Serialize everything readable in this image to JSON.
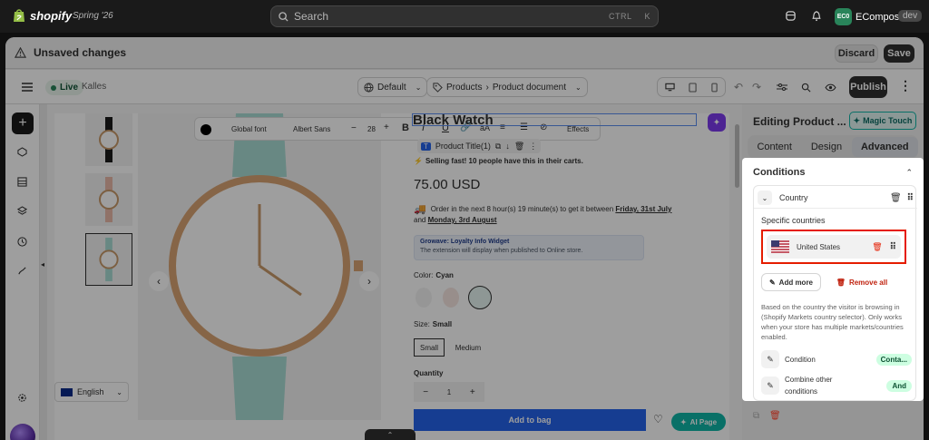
{
  "topbar": {
    "brand": "shopify",
    "season": "Spring '26",
    "search_placeholder": "Search",
    "shortcut_ctrl": "CTRL",
    "shortcut_key": "K",
    "avatar": "EC0",
    "store_name": "EComposer",
    "dev_badge": "dev"
  },
  "unsaved": {
    "title": "Unsaved changes",
    "discard": "Discard",
    "save": "Save"
  },
  "toolbar": {
    "live": "Live",
    "theme": "Kalles",
    "default": "Default",
    "products": "Products",
    "product_doc": "Product document",
    "publish": "Publish"
  },
  "text_toolbar": {
    "global_font": "Global font",
    "font_family": "Albert Sans",
    "font_size": "28",
    "effects": "Effects"
  },
  "product": {
    "title": "Black Watch",
    "element_label": "Product Title(1)",
    "urgency": "Selling fast! 10 people have this in their carts.",
    "price": "75.00 USD",
    "delivery_text": "Order in the next 8 hour(s) 19 minute(s) to get it between",
    "delivery_date1": "Friday, 31st July",
    "delivery_and": "and",
    "delivery_date2": "Monday, 3rd August",
    "loyalty_title": "Growave: Loyalty Info Widget",
    "loyalty_sub": "The extension will display when published to Online store.",
    "color_label": "Color:",
    "color_value": "Cyan",
    "size_label": "Size:",
    "size_value": "Small",
    "size_options": [
      "Small",
      "Medium"
    ],
    "quantity_label": "Quantity",
    "quantity": "1",
    "add_to_bag": "Add to bag",
    "ai_page": "AI Page",
    "language": "English"
  },
  "right_panel": {
    "title": "Editing Product ...",
    "magic": "Magic Touch",
    "tabs": [
      "Content",
      "Design",
      "Advanced"
    ],
    "conditions_heading": "Conditions",
    "country_label": "Country",
    "specific_countries": "Specific countries",
    "country_item": "United States",
    "add_more": "Add more",
    "remove_all": "Remove all",
    "description": "Based on the country the visitor is browsing in (Shopify Markets country selector). Only works when your store has multiple markets/countries enabled.",
    "condition_label": "Condition",
    "condition_badge": "Conta...",
    "combine_label1": "Combine other",
    "combine_label2": "conditions",
    "combine_badge": "And"
  },
  "colors": {
    "accent_green": "#29845a",
    "highlight_red": "#e51c00",
    "add_to_bag_blue": "#2563eb",
    "magic_teal": "#0fb5a7"
  }
}
